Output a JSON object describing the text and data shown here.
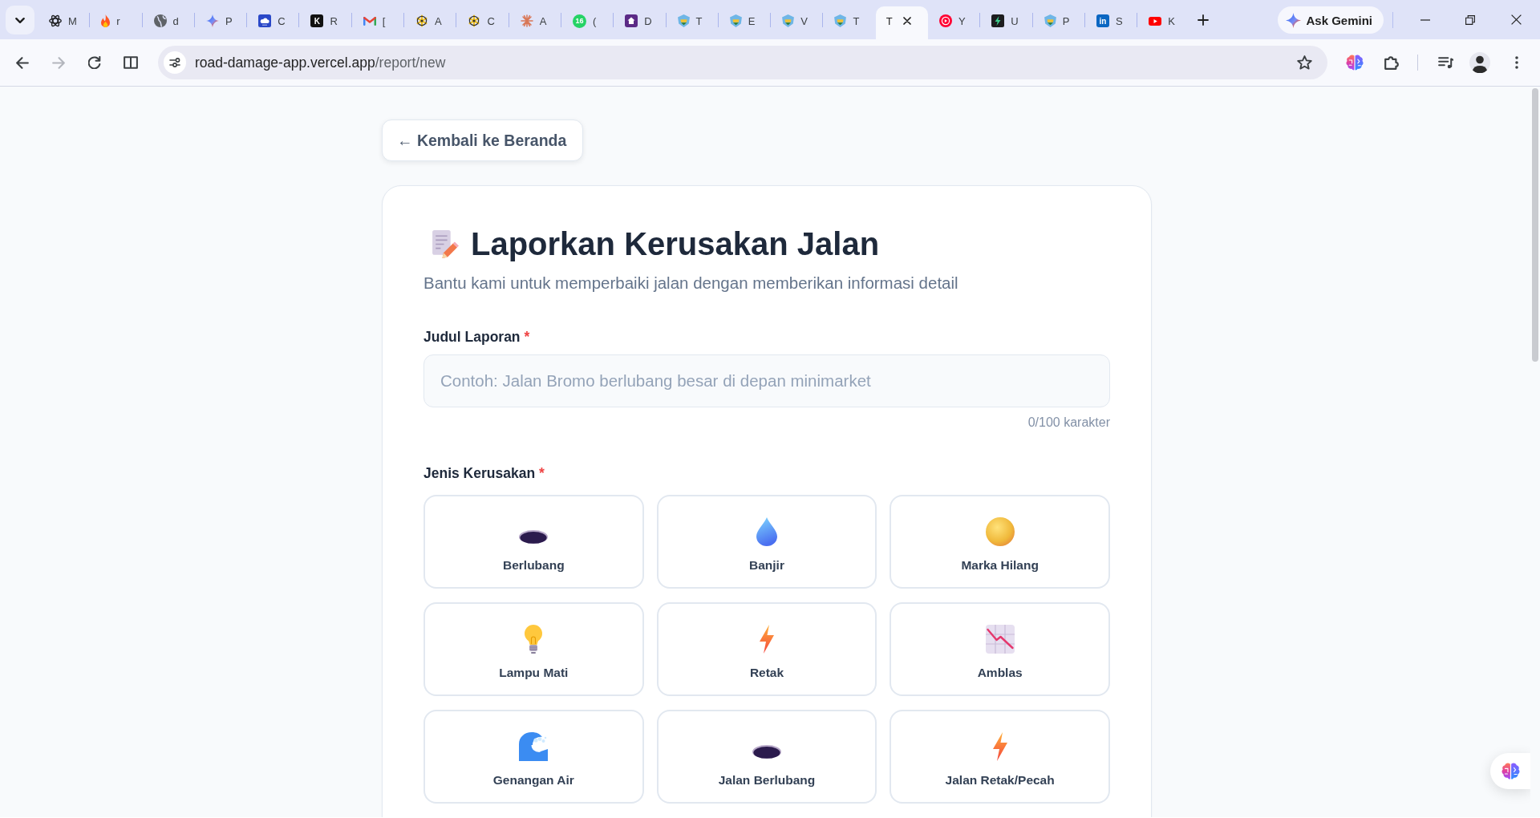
{
  "browser": {
    "tabs": [
      {
        "title": "M",
        "kind": "knot",
        "selected": false
      },
      {
        "title": "r",
        "kind": "flame",
        "selected": false
      },
      {
        "title": "d",
        "kind": "globe",
        "selected": false
      },
      {
        "title": "P",
        "kind": "sparkle",
        "selected": false
      },
      {
        "title": "C",
        "kind": "cloud",
        "selected": false
      },
      {
        "title": "R",
        "kind": "letter",
        "logo": "K",
        "color": "#111111",
        "selected": false
      },
      {
        "title": "[",
        "kind": "mail",
        "selected": false
      },
      {
        "title": "A",
        "kind": "wheel",
        "selected": false
      },
      {
        "title": "C",
        "kind": "wheel",
        "selected": false
      },
      {
        "title": "A",
        "kind": "burst",
        "selected": false
      },
      {
        "title": "(",
        "kind": "counter",
        "badge": "16",
        "selected": false
      },
      {
        "title": "D",
        "kind": "house",
        "selected": false
      },
      {
        "title": "T",
        "kind": "crest",
        "selected": false
      },
      {
        "title": "E",
        "kind": "crest",
        "selected": false
      },
      {
        "title": "V",
        "kind": "crest",
        "selected": false
      },
      {
        "title": "T",
        "kind": "crest",
        "selected": false
      },
      {
        "title": "T",
        "selected": true
      },
      {
        "title": "Y",
        "kind": "ring",
        "selected": false
      },
      {
        "title": "U",
        "kind": "bolt",
        "selected": false
      },
      {
        "title": "P",
        "kind": "crest",
        "selected": false
      },
      {
        "title": "S",
        "kind": "letter",
        "logo": "in",
        "color": "#0a66c2",
        "selected": false
      },
      {
        "title": "K",
        "kind": "play",
        "selected": false
      }
    ],
    "ask_button": "Ask Gemini",
    "address": {
      "host": "road-damage-app.vercel.app",
      "path": "/report/new"
    },
    "forward_disabled": true
  },
  "page": {
    "back_button": "← Kembali ke Beranda",
    "form": {
      "title": "Laporkan Kerusakan Jalan",
      "subtitle": "Bantu kami untuk memperbaiki jalan dengan memberikan informasi detail",
      "report_title": {
        "label": "Judul Laporan",
        "required_mark": "*",
        "placeholder": "Contoh: Jalan Bromo berlubang besar di depan minimarket",
        "counter": "0/100 karakter"
      },
      "damage_type": {
        "label": "Jenis Kerusakan",
        "required_mark": "*",
        "options": [
          {
            "label": "Berlubang",
            "kind": "hole",
            "selected": false
          },
          {
            "label": "Banjir",
            "kind": "drop",
            "selected": false
          },
          {
            "label": "Marka Hilang",
            "kind": "ball",
            "selected": false
          },
          {
            "label": "Lampu Mati",
            "kind": "bulb",
            "selected": false
          },
          {
            "label": "Retak",
            "kind": "bolt",
            "selected": false
          },
          {
            "label": "Amblas",
            "kind": "chart",
            "selected": false
          },
          {
            "label": "Genangan Air",
            "kind": "wave",
            "selected": false
          },
          {
            "label": "Jalan Berlubang",
            "kind": "hole",
            "selected": false
          },
          {
            "label": "Jalan Retak/Pecah",
            "kind": "bolt",
            "selected": false
          }
        ]
      }
    }
  }
}
